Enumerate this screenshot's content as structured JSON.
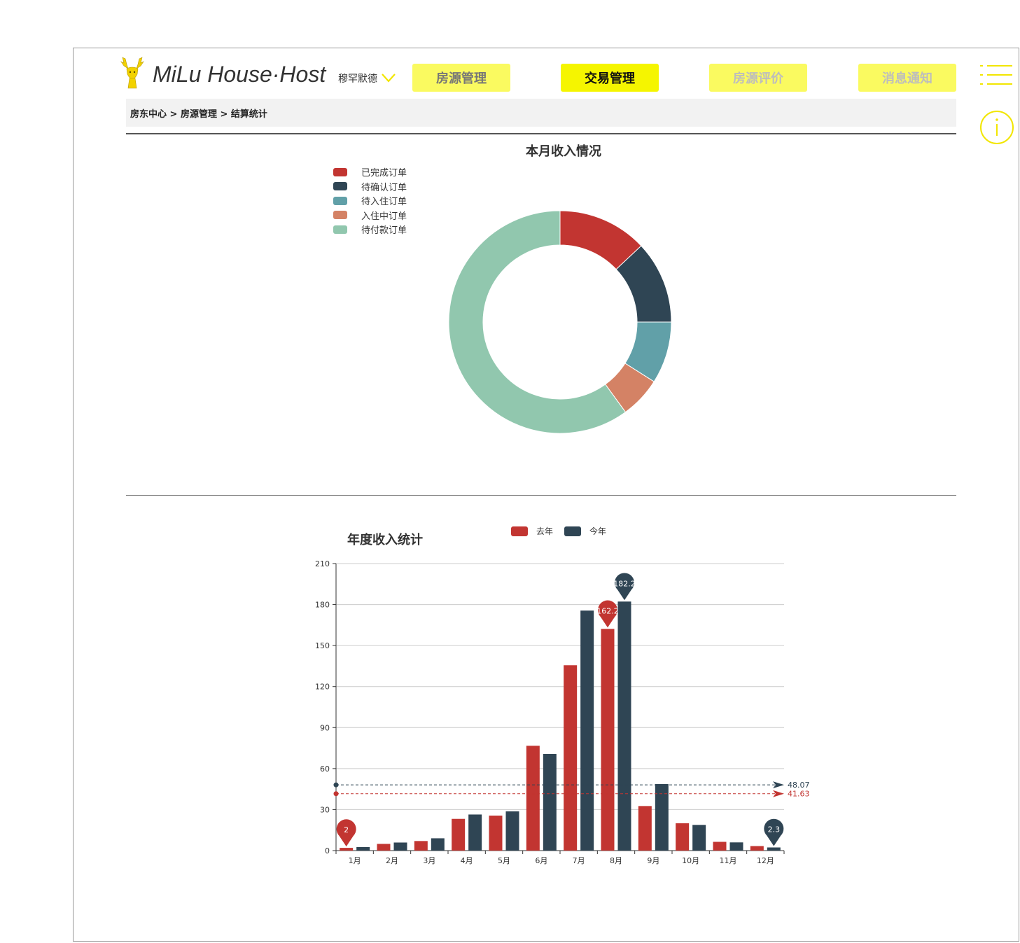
{
  "header": {
    "brand": "MiLu House·Host",
    "user_name": "穆罕默德",
    "nav": [
      {
        "label": "房源管理",
        "state": "normal"
      },
      {
        "label": "交易管理",
        "state": "active"
      },
      {
        "label": "房源评价",
        "state": "dim"
      },
      {
        "label": "消息通知",
        "state": "dim"
      }
    ],
    "accent_color": "#f5f500"
  },
  "breadcrumb": "房东中心 > 房源管理 > 结算统计",
  "chart_data": [
    {
      "type": "pie",
      "title": "本月收入情况",
      "legend_position": "top-left",
      "slices": [
        {
          "name": "已完成订单",
          "value": 13,
          "color": "#c23531"
        },
        {
          "name": "待确认订单",
          "value": 12,
          "color": "#2f4554"
        },
        {
          "name": "待入住订单",
          "value": 9,
          "color": "#61a0a8"
        },
        {
          "name": "入住中订单",
          "value": 6,
          "color": "#d48265"
        },
        {
          "name": "待付款订单",
          "value": 60,
          "color": "#91c7ae"
        }
      ]
    },
    {
      "type": "bar",
      "title": "年度收入统计",
      "legend_position": "top",
      "categories": [
        "1月",
        "2月",
        "3月",
        "4月",
        "5月",
        "6月",
        "7月",
        "8月",
        "9月",
        "10月",
        "11月",
        "12月"
      ],
      "ylim": [
        0,
        210
      ],
      "yticks": [
        0,
        30,
        60,
        90,
        120,
        150,
        180,
        210
      ],
      "grid": true,
      "series": [
        {
          "name": "去年",
          "color": "#c23531",
          "values": [
            2,
            4.9,
            7,
            23.2,
            25.6,
            76.7,
            135.6,
            162.2,
            32.6,
            20,
            6.4,
            3.3
          ],
          "max_label": "162.2",
          "min_label": "2",
          "mean": 41.63,
          "mean_label": "41.63"
        },
        {
          "name": "今年",
          "color": "#2f4554",
          "values": [
            2.6,
            5.9,
            9,
            26.4,
            28.7,
            70.7,
            175.6,
            182.2,
            48.7,
            18.8,
            6,
            2.3
          ],
          "max_label": "182.2",
          "min_label": "2.3",
          "mean": 48.07,
          "mean_label": "48.07"
        }
      ]
    }
  ]
}
